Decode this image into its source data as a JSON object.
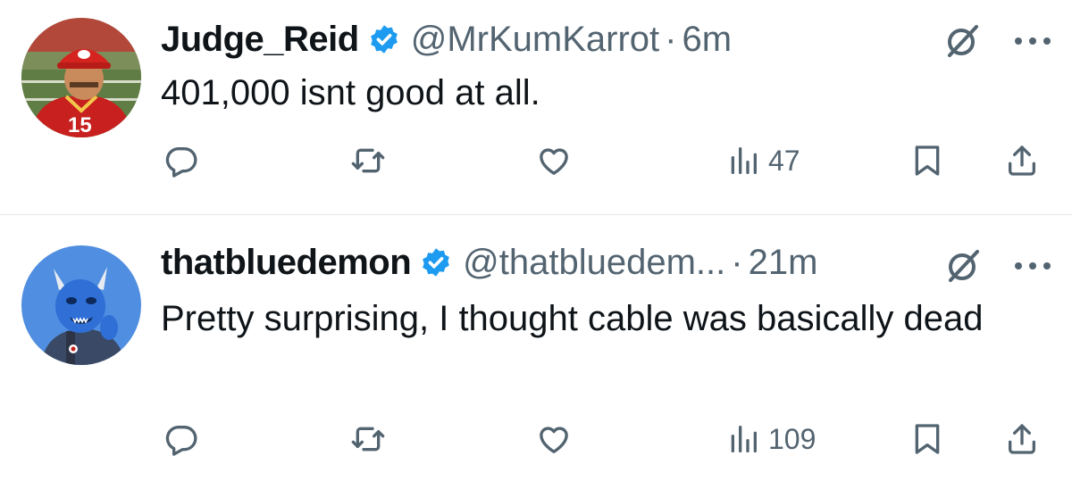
{
  "tweets": [
    {
      "display_name": "Judge_Reid",
      "handle": "@MrKumKarrot",
      "separator": "·",
      "time": "6m",
      "text": "401,000 isnt good at all.",
      "views": "47",
      "avatar": "kansas-city-football-fan-cartoon"
    },
    {
      "display_name": "thatbluedemon",
      "handle": "@thatbluedem...",
      "separator": "·",
      "time": "21m",
      "text": "Pretty surprising, I thought cable was basically dead",
      "views": "109",
      "avatar": "blue-demon-cartoon"
    }
  ],
  "colors": {
    "text": "#0f1419",
    "secondary": "#536471",
    "verified": "#1d9bf0",
    "divider": "#e3e6e8"
  },
  "icons": [
    "reply-icon",
    "repost-icon",
    "like-icon",
    "views-icon",
    "bookmark-icon",
    "share-icon",
    "grok-icon",
    "more-icon",
    "verified-badge-icon"
  ]
}
